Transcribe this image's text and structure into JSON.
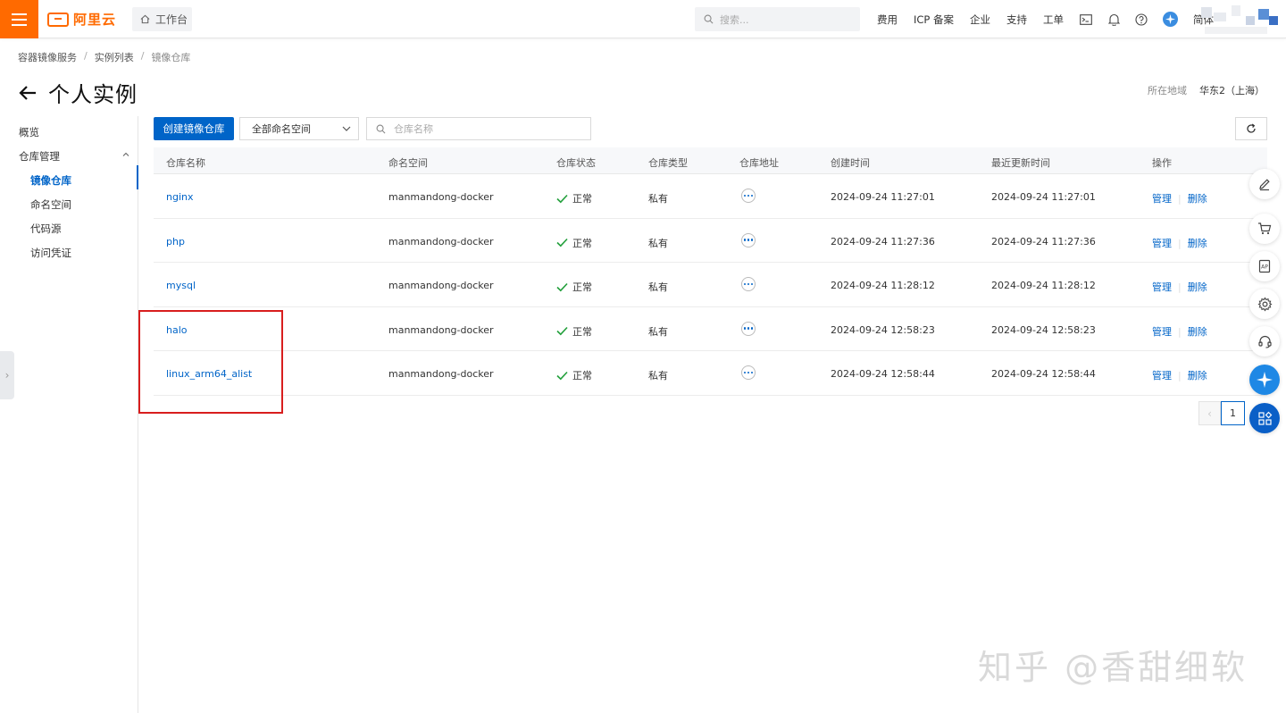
{
  "topbar": {
    "logo_text": "阿里云",
    "workbench": "工作台",
    "search_placeholder": "搜索...",
    "nav": [
      "费用",
      "ICP 备案",
      "企业",
      "支持",
      "工单"
    ],
    "lang": "简体",
    "icons": [
      "terminal-icon",
      "bell-icon",
      "help-icon",
      "assistant-icon"
    ]
  },
  "breadcrumb": [
    "容器镜像服务",
    "实例列表",
    "镜像仓库"
  ],
  "page_title": "个人实例",
  "region": {
    "label": "所在地域",
    "value": "华东2（上海）"
  },
  "sidebar": {
    "overview": "概览",
    "repo_mgmt": "仓库管理",
    "items": [
      "镜像仓库",
      "命名空间",
      "代码源",
      "访问凭证"
    ]
  },
  "toolbar": {
    "create_label": "创建镜像仓库",
    "namespace_selected": "全部命名空间",
    "search_placeholder": "仓库名称"
  },
  "table": {
    "headers": [
      "仓库名称",
      "命名空间",
      "仓库状态",
      "仓库类型",
      "仓库地址",
      "创建时间",
      "最近更新时间",
      "操作"
    ],
    "rows": [
      {
        "name": "nginx",
        "namespace": "manmandong-docker",
        "status": "正常",
        "type": "私有",
        "created": "2024-09-24 11:27:01",
        "updated": "2024-09-24 11:27:01"
      },
      {
        "name": "php",
        "namespace": "manmandong-docker",
        "status": "正常",
        "type": "私有",
        "created": "2024-09-24 11:27:36",
        "updated": "2024-09-24 11:27:36"
      },
      {
        "name": "mysql",
        "namespace": "manmandong-docker",
        "status": "正常",
        "type": "私有",
        "created": "2024-09-24 11:28:12",
        "updated": "2024-09-24 11:28:12"
      },
      {
        "name": "halo",
        "namespace": "manmandong-docker",
        "status": "正常",
        "type": "私有",
        "created": "2024-09-24 12:58:23",
        "updated": "2024-09-24 12:58:23"
      },
      {
        "name": "linux_arm64_alist",
        "namespace": "manmandong-docker",
        "status": "正常",
        "type": "私有",
        "created": "2024-09-24 12:58:44",
        "updated": "2024-09-24 12:58:44"
      }
    ],
    "op_manage": "管理",
    "op_delete": "删除"
  },
  "pagination": {
    "current": "1"
  },
  "watermark": "知乎 @香甜细软",
  "colors": {
    "brand": "#ff6a00",
    "primary": "#0064c8",
    "success": "#23a03c",
    "highlight": "#d81e1e"
  }
}
